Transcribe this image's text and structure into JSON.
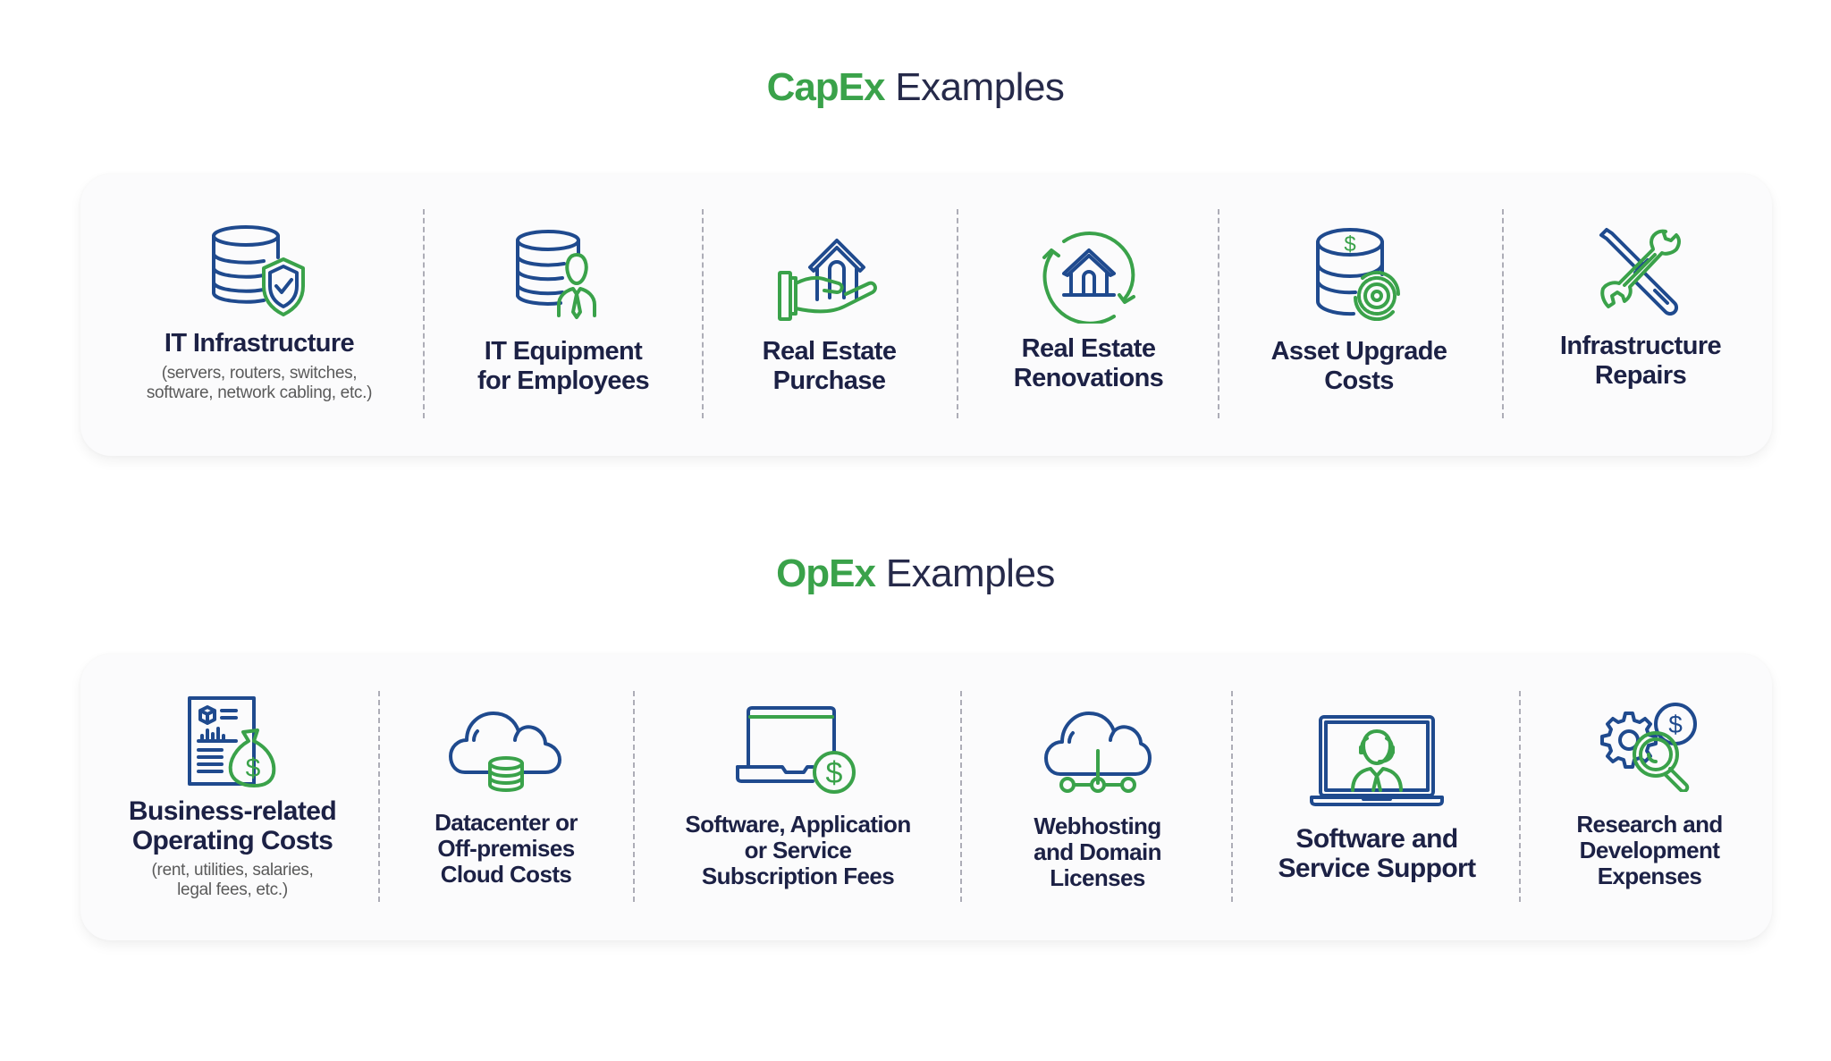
{
  "colors": {
    "accent_green": "#3aa24a",
    "icon_blue": "#1f4a8e",
    "title_navy": "#1c2145",
    "subtitle_gray": "#5a5a5a",
    "card_background": "#fbfbfc"
  },
  "capex": {
    "title_accent": "CapEx",
    "title_rest": " Examples",
    "items": [
      {
        "icon": "database-shield-icon",
        "title": [
          "IT Infrastructure"
        ],
        "subtitle": [
          "(servers, routers, switches,",
          "software, network cabling, etc.)"
        ]
      },
      {
        "icon": "database-employee-icon",
        "title": [
          "IT Equipment",
          "for Employees"
        ]
      },
      {
        "icon": "house-in-hand-icon",
        "title": [
          "Real Estate",
          "Purchase"
        ]
      },
      {
        "icon": "house-refresh-icon",
        "title": [
          "Real Estate",
          "Renovations"
        ]
      },
      {
        "icon": "coins-gear-icon",
        "title": [
          "Asset Upgrade",
          "Costs"
        ]
      },
      {
        "icon": "wrench-screwdriver-icon",
        "title": [
          "Infrastructure",
          "Repairs"
        ]
      }
    ]
  },
  "opex": {
    "title_accent": "OpEx",
    "title_rest": " Examples",
    "items": [
      {
        "icon": "report-money-bag-icon",
        "title": [
          "Business-related",
          "Operating Costs"
        ],
        "subtitle": [
          "(rent, utilities, salaries,",
          "legal fees, etc.)"
        ]
      },
      {
        "icon": "cloud-database-icon",
        "title": [
          "Datacenter or",
          "Off-premises",
          "Cloud Costs"
        ]
      },
      {
        "icon": "laptop-dollar-icon",
        "title": [
          "Software, Application",
          "or Service",
          "Subscription Fees"
        ]
      },
      {
        "icon": "cloud-network-icon",
        "title": [
          "Webhosting",
          "and Domain",
          "Licenses"
        ]
      },
      {
        "icon": "laptop-support-agent-icon",
        "title": [
          "Software and",
          "Service Support"
        ]
      },
      {
        "icon": "gear-dollar-magnifier-icon",
        "title": [
          "Research and",
          "Development",
          "Expenses"
        ]
      }
    ]
  }
}
